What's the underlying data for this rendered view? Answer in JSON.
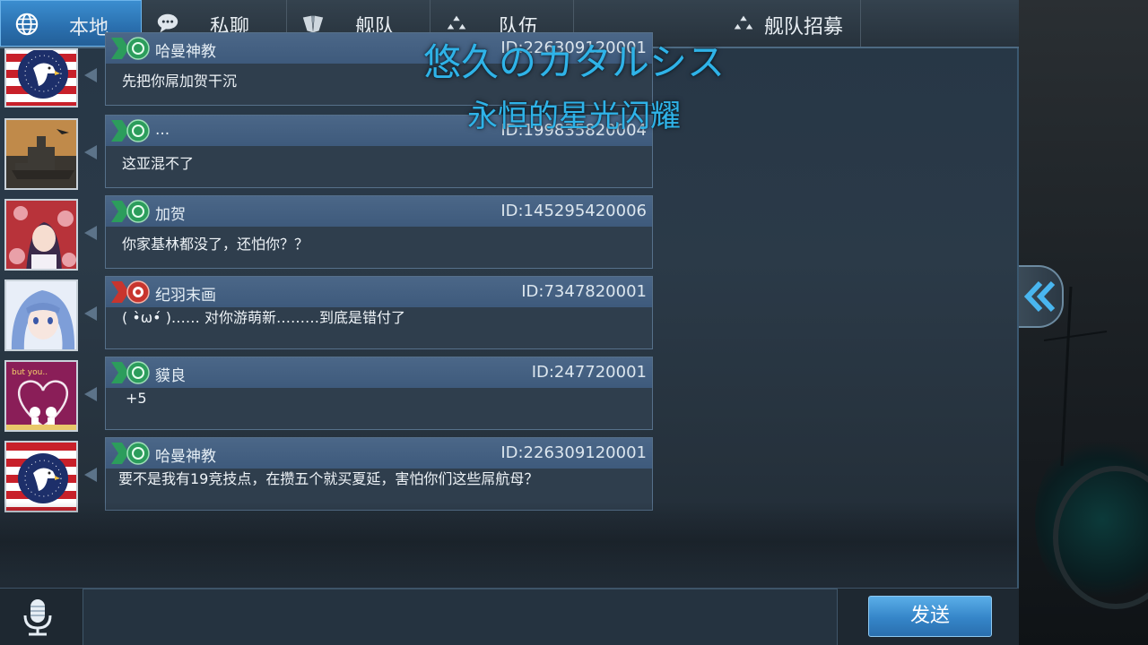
{
  "tabs": [
    {
      "label": "本地",
      "icon": "globe-icon",
      "active": true
    },
    {
      "label": "私聊",
      "icon": "chat-bubble-icon",
      "active": false
    },
    {
      "label": "舰队",
      "icon": "fleet-icon",
      "active": false
    },
    {
      "label": "队伍",
      "icon": "team-icon",
      "active": false
    },
    {
      "label": "舰队招募",
      "icon": "team-icon",
      "active": false
    }
  ],
  "overlay": {
    "title_jp": "悠久のカタルシス",
    "title_cn": "永恒的星光闪耀"
  },
  "messages": [
    {
      "name": "哈曼神教",
      "id": "ID:226309120001",
      "text": "先把你屌加贺干沉",
      "avatar": "eagle-flag-avatar",
      "badge": "green"
    },
    {
      "name": "...",
      "id": "ID:199835820004",
      "text": "这亚混不了",
      "avatar": "battleship-avatar",
      "badge": "green"
    },
    {
      "name": "加贺",
      "id": "ID:145295420006",
      "text": "你家基林都没了，还怕你？？",
      "avatar": "anime-girl-red-avatar",
      "badge": "green"
    },
    {
      "name": "纪羽末画",
      "id": "ID:7347820001",
      "text": "( •̀ω•́ )…… 对你游萌新………到底是错付了",
      "avatar": "anime-girl-blue-avatar",
      "badge": "red"
    },
    {
      "name": "貘良",
      "id": "ID:247720001",
      "text": "+5",
      "avatar": "heart-couple-avatar",
      "badge": "green"
    },
    {
      "name": "哈曼神教",
      "id": "ID:226309120001",
      "text": "要不是我有19竞技点，在攒五个就买夏延，害怕你们这些屌航母？",
      "avatar": "eagle-flag-avatar",
      "badge": "green"
    }
  ],
  "input": {
    "value": "",
    "placeholder": ""
  },
  "send_label": "发送",
  "colors": {
    "accent": "#3585c8",
    "overlay_text": "#2fb3e8",
    "bubble_header": "#45618a"
  }
}
